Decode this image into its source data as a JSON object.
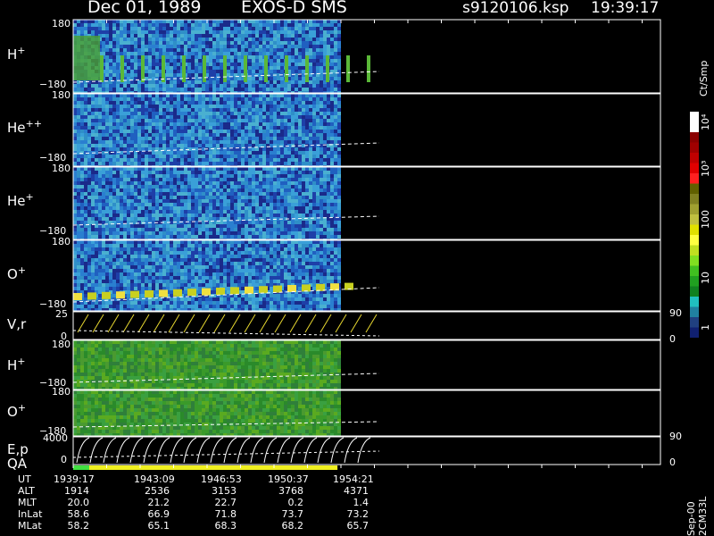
{
  "header": {
    "date": "Dec 01, 1989",
    "mission": "EXOS-D SMS",
    "file": "s9120106.ksp",
    "time": "19:39:17"
  },
  "panels": [
    {
      "species": "H",
      "charge": "+",
      "ymax": "180",
      "ymin": "−180"
    },
    {
      "species": "He",
      "charge": "++",
      "ymax": "180",
      "ymin": "−180"
    },
    {
      "species": "He",
      "charge": "+",
      "ymax": "180",
      "ymin": "−180"
    },
    {
      "species": "O",
      "charge": "+",
      "ymax": "180",
      "ymin": "−180"
    },
    {
      "species": "V,r",
      "charge": "",
      "ymax": "25",
      "ymin": "0",
      "rmax": "90",
      "rmin": "0"
    },
    {
      "species": "H",
      "charge": "+",
      "ymax": "180",
      "ymin": "−180"
    },
    {
      "species": "O",
      "charge": "+",
      "ymax": "180",
      "ymin": "−180"
    },
    {
      "species": "E,p",
      "charge": "",
      "ymax": "4000",
      "ymin": "0",
      "rmax": "90",
      "rmin": "0"
    }
  ],
  "qa_label": "QA",
  "colorbar": {
    "unit": "Ct/Smp",
    "ticks": [
      "10⁴",
      "10³",
      "100",
      "10",
      "1"
    ]
  },
  "side_note": "Sep-00 2CM33L",
  "ephemeris": {
    "labels": [
      "UT",
      "ALT",
      "MLT",
      "InLat",
      "MLat"
    ],
    "columns": [
      [
        "1939:17",
        "1914",
        "20.0",
        "58.6",
        "58.2"
      ],
      [
        "1943:09",
        "2536",
        "21.2",
        "66.9",
        "65.1"
      ],
      [
        "1946:53",
        "3153",
        "22.7",
        "71.8",
        "68.3"
      ],
      [
        "1950:37",
        "3768",
        "0.2",
        "73.7",
        "68.2"
      ],
      [
        "1954:21",
        "4371",
        "1.4",
        "73.2",
        "65.7"
      ]
    ]
  },
  "chart_data": {
    "type": "heatmap",
    "title": "Dec 01, 1989   EXOS-D SMS",
    "x_ticks": [
      "1939:17",
      "1943:09",
      "1946:53",
      "1950:37",
      "1954:21"
    ],
    "colorbar_range": [
      1,
      10000
    ],
    "colorbar_scale": "log",
    "panels": [
      {
        "name": "H+",
        "ylim": [
          -180,
          180
        ]
      },
      {
        "name": "He++",
        "ylim": [
          -180,
          180
        ]
      },
      {
        "name": "He+",
        "ylim": [
          -180,
          180
        ]
      },
      {
        "name": "O+",
        "ylim": [
          -180,
          180
        ]
      },
      {
        "name": "V,r",
        "ylim": [
          0,
          25
        ],
        "right_ylim": [
          0,
          90
        ]
      },
      {
        "name": "H+",
        "ylim": [
          -180,
          180
        ]
      },
      {
        "name": "O+",
        "ylim": [
          -180,
          180
        ]
      },
      {
        "name": "E,p",
        "ylim": [
          0,
          4000
        ],
        "right_ylim": [
          0,
          90
        ]
      }
    ],
    "data_coverage_fraction": 0.45
  }
}
